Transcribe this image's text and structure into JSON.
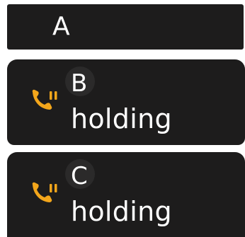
{
  "calls": [
    {
      "name": "A"
    },
    {
      "name": "B",
      "status": "holding",
      "icon": "phone-hold-icon"
    },
    {
      "name": "C",
      "status": "holding",
      "icon": "phone-hold-icon"
    }
  ],
  "colors": {
    "card_bg": "#1d1c1c",
    "icon_orange": "#f3a61b",
    "text": "#ffffff"
  }
}
